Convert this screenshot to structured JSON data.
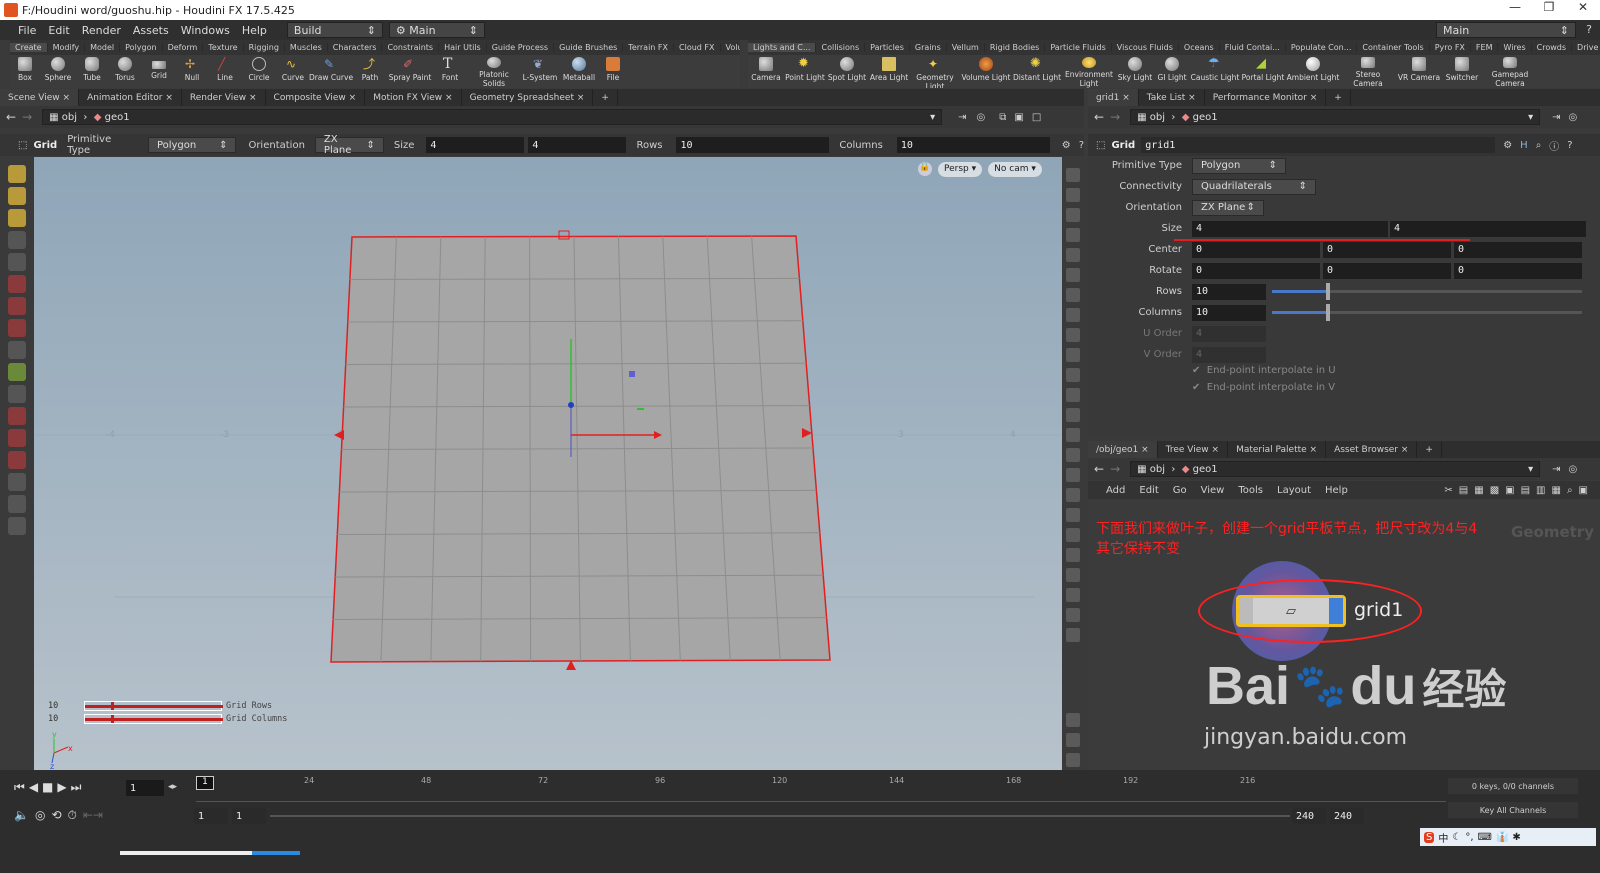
{
  "title": "F:/Houdini word/guoshu.hip - Houdini FX 17.5.425",
  "menu": [
    "File",
    "Edit",
    "Render",
    "Assets",
    "Windows",
    "Help"
  ],
  "desktop_build": "Build",
  "desktop_main": "Main",
  "desktop_main_right": "Main",
  "shelf_tabs_left": [
    "Create",
    "Modify",
    "Model",
    "Polygon",
    "Deform",
    "Texture",
    "Rigging",
    "Muscles",
    "Characters",
    "Constraints",
    "Hair Utils",
    "Guide Process",
    "Guide Brushes",
    "Terrain FX",
    "Cloud FX",
    "Volume"
  ],
  "shelf_tools_left": [
    "Box",
    "Sphere",
    "Tube",
    "Torus",
    "Grid",
    "Null",
    "Line",
    "Circle",
    "Curve",
    "Draw Curve",
    "Path",
    "Spray Paint",
    "Font",
    "Platonic Solids",
    "L-System",
    "Metaball",
    "File"
  ],
  "shelf_tabs_right": [
    "Lights and C...",
    "Collisions",
    "Particles",
    "Grains",
    "Vellum",
    "Rigid Bodies",
    "Particle Fluids",
    "Viscous Fluids",
    "Oceans",
    "Fluid Contai...",
    "Populate Con...",
    "Container Tools",
    "Pyro FX",
    "FEM",
    "Wires",
    "Crowds",
    "Drive Simula..."
  ],
  "shelf_tools_right": [
    "Camera",
    "Point Light",
    "Spot Light",
    "Area Light",
    "Geometry Light",
    "Volume Light",
    "Distant Light",
    "Environment Light",
    "Sky Light",
    "GI Light",
    "Caustic Light",
    "Portal Light",
    "Ambient Light",
    "Stereo Camera",
    "VR Camera",
    "Switcher",
    "Gamepad Camera"
  ],
  "viewer_tabs": [
    "Scene View",
    "Animation Editor",
    "Render View",
    "Composite View",
    "Motion FX View",
    "Geometry Spreadsheet"
  ],
  "path": {
    "obj": "obj",
    "geo": "geo1"
  },
  "opbar": {
    "node": "Grid",
    "prim_label": "Primitive Type",
    "prim_value": "Polygon",
    "orient_label": "Orientation",
    "orient_value": "ZX Plane",
    "size_label": "Size",
    "size_x": "4",
    "size_y": "4",
    "rows_label": "Rows",
    "rows": "10",
    "cols_label": "Columns",
    "cols": "10"
  },
  "viewport": {
    "persp": "Persp",
    "cam": "No cam",
    "hud_rows_value": "10",
    "hud_rows_label": "Grid Rows",
    "hud_cols_value": "10",
    "hud_cols_label": "Grid Columns"
  },
  "param_tabs": [
    "grid1",
    "Take List",
    "Performance Monitor"
  ],
  "params": {
    "type": "Grid",
    "name": "grid1",
    "prim_label": "Primitive Type",
    "prim": "Polygon",
    "conn_label": "Connectivity",
    "conn": "Quadrilaterals",
    "orient_label": "Orientation",
    "orient": "ZX Plane",
    "size_label": "Size",
    "size_x": "4",
    "size_y": "4",
    "center_label": "Center",
    "center": [
      "0",
      "0",
      "0"
    ],
    "rotate_label": "Rotate",
    "rotate": [
      "0",
      "0",
      "0"
    ],
    "rows_label": "Rows",
    "rows": "10",
    "cols_label": "Columns",
    "cols": "10",
    "uorder_label": "U Order",
    "uorder": "4",
    "vorder_label": "V Order",
    "vorder": "4",
    "endu": "End-point interpolate in U",
    "endv": "End-point interpolate in V"
  },
  "network_tabs": [
    "/obj/geo1",
    "Tree View",
    "Material Palette",
    "Asset Browser"
  ],
  "network_menu": [
    "Add",
    "Edit",
    "Go",
    "View",
    "Tools",
    "Layout",
    "Help"
  ],
  "network": {
    "annotation_line1": "下面我们来做叶子，创建一个grid平板节点，把尺寸改为4与4",
    "annotation_line2": "其它保持不变",
    "context_label": "Geometry",
    "node_name": "grid1"
  },
  "watermark": {
    "brand": "Bai",
    "du": "du",
    "cn": "经验",
    "url": "jingyan.baidu.com"
  },
  "timeline": {
    "frame": "1",
    "ticks": [
      "24",
      "48",
      "72",
      "96",
      "120",
      "144",
      "168",
      "192",
      "216"
    ],
    "start": "1",
    "start2": "1",
    "end": "240",
    "end2": "240",
    "keys": "0 keys, 0/0 channels",
    "keyall": "Key All Channels"
  },
  "taskbar": {
    "ime": "中"
  },
  "colors": {
    "grid_edge": "#e02020",
    "annotation": "#ff2020",
    "node_blue": "#3f7fd8"
  }
}
